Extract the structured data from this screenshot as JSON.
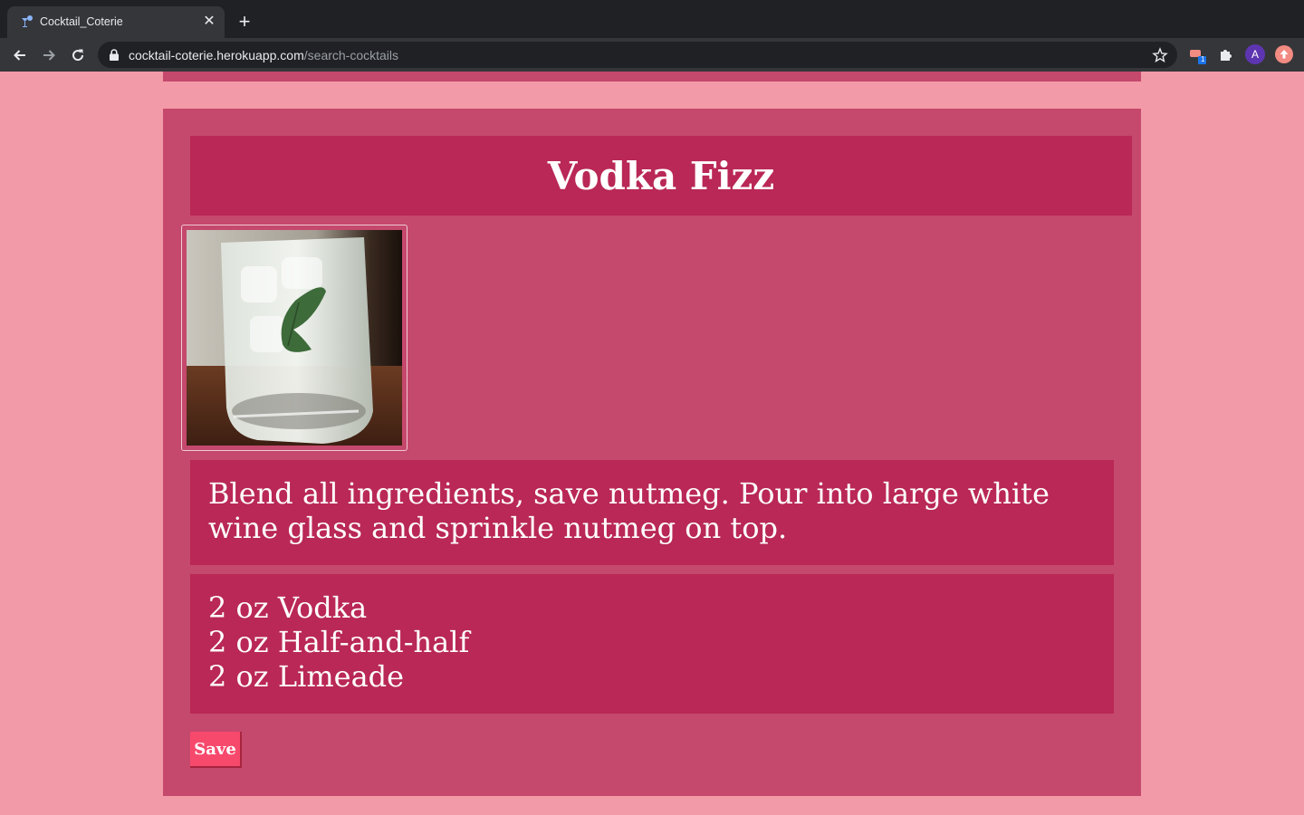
{
  "browser": {
    "tab_title": "Cocktail_Coterie",
    "url_host": "cocktail-coterie.herokuapp.com",
    "url_path": "/search-cocktails",
    "avatar_letter": "A",
    "extension_badge": "1"
  },
  "cocktail": {
    "name": "Vodka Fizz",
    "image_alt": "glass-of-vodka-fizz-with-mint",
    "instructions": "Blend all ingredients, save nutmeg. Pour into large white wine glass and sprinkle nutmeg on top.",
    "ingredients": [
      "2 oz Vodka",
      "2 oz Half-and-half",
      "2 oz Limeade"
    ],
    "save_label": "Save"
  },
  "colors": {
    "page_bg": "#f29aa7",
    "card_bg": "#c5486d",
    "panel_bg": "#b92856",
    "button_bg": "#f7496c"
  },
  "icons": [
    "back-icon",
    "forward-icon",
    "reload-icon",
    "lock-icon",
    "star-icon",
    "extensions-icon",
    "update-icon"
  ]
}
